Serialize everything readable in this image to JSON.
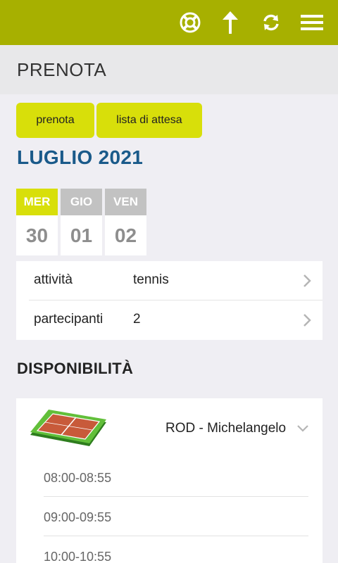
{
  "topbar": {
    "icons": [
      "lifebuoy-icon",
      "arrow-up-icon",
      "refresh-icon",
      "hamburger-menu-icon"
    ],
    "accent_color": "#a7b000"
  },
  "header": {
    "title": "PRENOTA"
  },
  "tabs": [
    {
      "label": "prenota"
    },
    {
      "label": "lista di attesa"
    }
  ],
  "calendar": {
    "month": "LUGLIO 2021",
    "days": [
      {
        "name": "MER",
        "number": "30",
        "selected": true
      },
      {
        "name": "GIO",
        "number": "01",
        "selected": false
      },
      {
        "name": "VEN",
        "number": "02",
        "selected": false
      }
    ]
  },
  "filters": [
    {
      "label": "attività",
      "value": "tennis"
    },
    {
      "label": "partecipanti",
      "value": "2"
    }
  ],
  "availability": {
    "title": "DISPONIBILITÀ",
    "court": {
      "name": "ROD - Michelangelo",
      "icon": "tennis-court-icon",
      "slots": [
        "08:00-08:55",
        "09:00-09:55",
        "10:00-10:55"
      ]
    }
  }
}
